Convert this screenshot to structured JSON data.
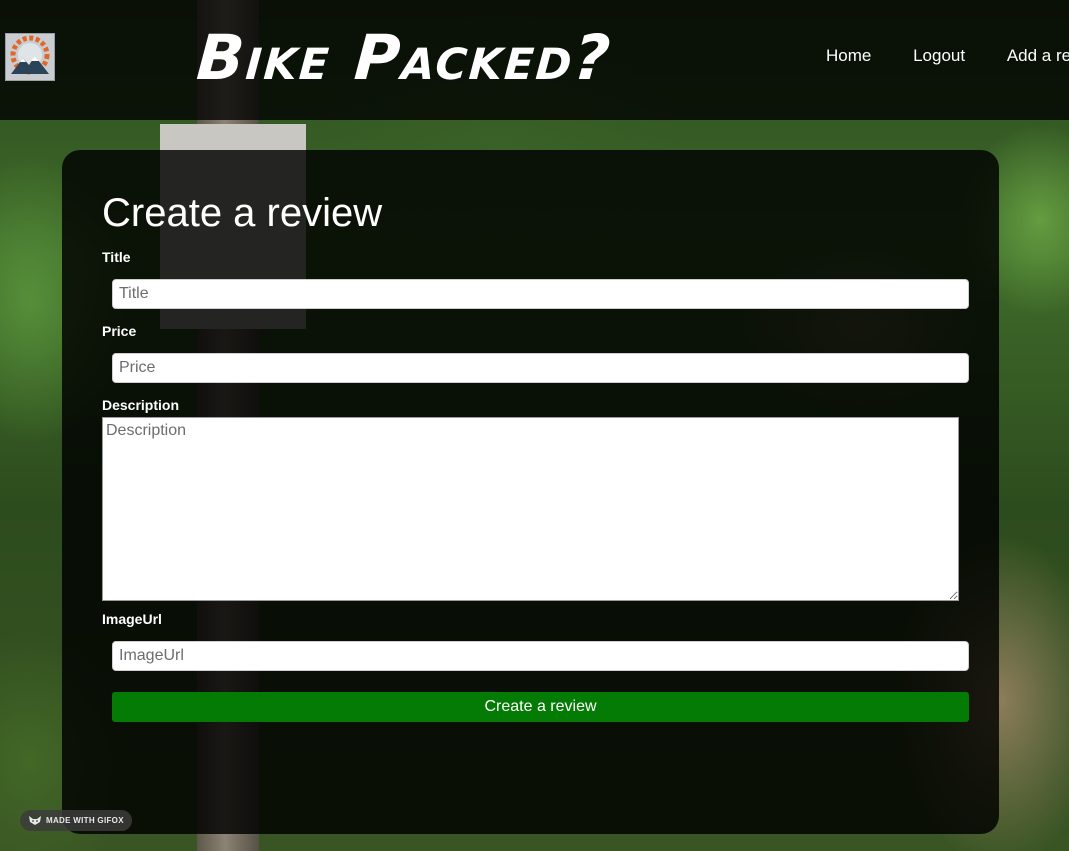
{
  "header": {
    "brand": "Bike Packed?",
    "logo": "bike-gear-mountain-logo",
    "nav": [
      {
        "label": "Home"
      },
      {
        "label": "Logout"
      },
      {
        "label": "Add a review"
      }
    ]
  },
  "form": {
    "heading": "Create a review",
    "fields": {
      "title": {
        "label": "Title",
        "placeholder": "Title",
        "value": ""
      },
      "price": {
        "label": "Price",
        "placeholder": "Price",
        "value": ""
      },
      "description": {
        "label": "Description",
        "placeholder": "Description",
        "value": ""
      },
      "image_url": {
        "label": "ImageUrl",
        "placeholder": "ImageUrl",
        "value": ""
      }
    },
    "submit_label": "Create a review"
  },
  "watermark": {
    "text": "MADE WITH GIFOX",
    "icon": "fox-icon"
  },
  "colors": {
    "submit_button": "#047b04",
    "panel": "rgba(0,0,0,0.82)",
    "text": "#ffffff"
  }
}
